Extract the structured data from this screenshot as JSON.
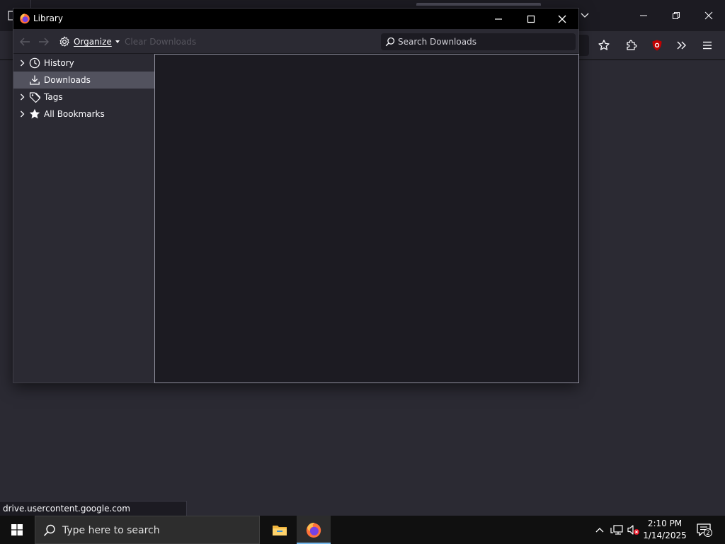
{
  "library": {
    "title": "Library",
    "toolbar": {
      "organize_label": "Organize",
      "clear_downloads_label": "Clear Downloads"
    },
    "search": {
      "placeholder": "Search Downloads",
      "value": ""
    },
    "sidebar": {
      "items": [
        {
          "label": "History",
          "icon": "clock-icon",
          "expandable": true,
          "selected": false
        },
        {
          "label": "Downloads",
          "icon": "download-icon",
          "expandable": false,
          "selected": true
        },
        {
          "label": "Tags",
          "icon": "tag-icon",
          "expandable": true,
          "selected": false
        },
        {
          "label": "All Bookmarks",
          "icon": "star-icon",
          "expandable": true,
          "selected": false
        }
      ]
    }
  },
  "status_bar": {
    "url": "drive.usercontent.google.com"
  },
  "taskbar": {
    "search_placeholder": "Type here to search",
    "clock": {
      "time": "2:10 PM",
      "date": "1/14/2025"
    },
    "notification_count": "2"
  },
  "colors": {
    "window_bg": "#2b2a33",
    "titlebar_bg": "#000000",
    "content_bg": "#1c1b22",
    "selected_bg": "#52525e",
    "taskbar_bg": "#101010",
    "ublock_red": "#c20000",
    "taskbar_accent": "#76b9ed"
  }
}
